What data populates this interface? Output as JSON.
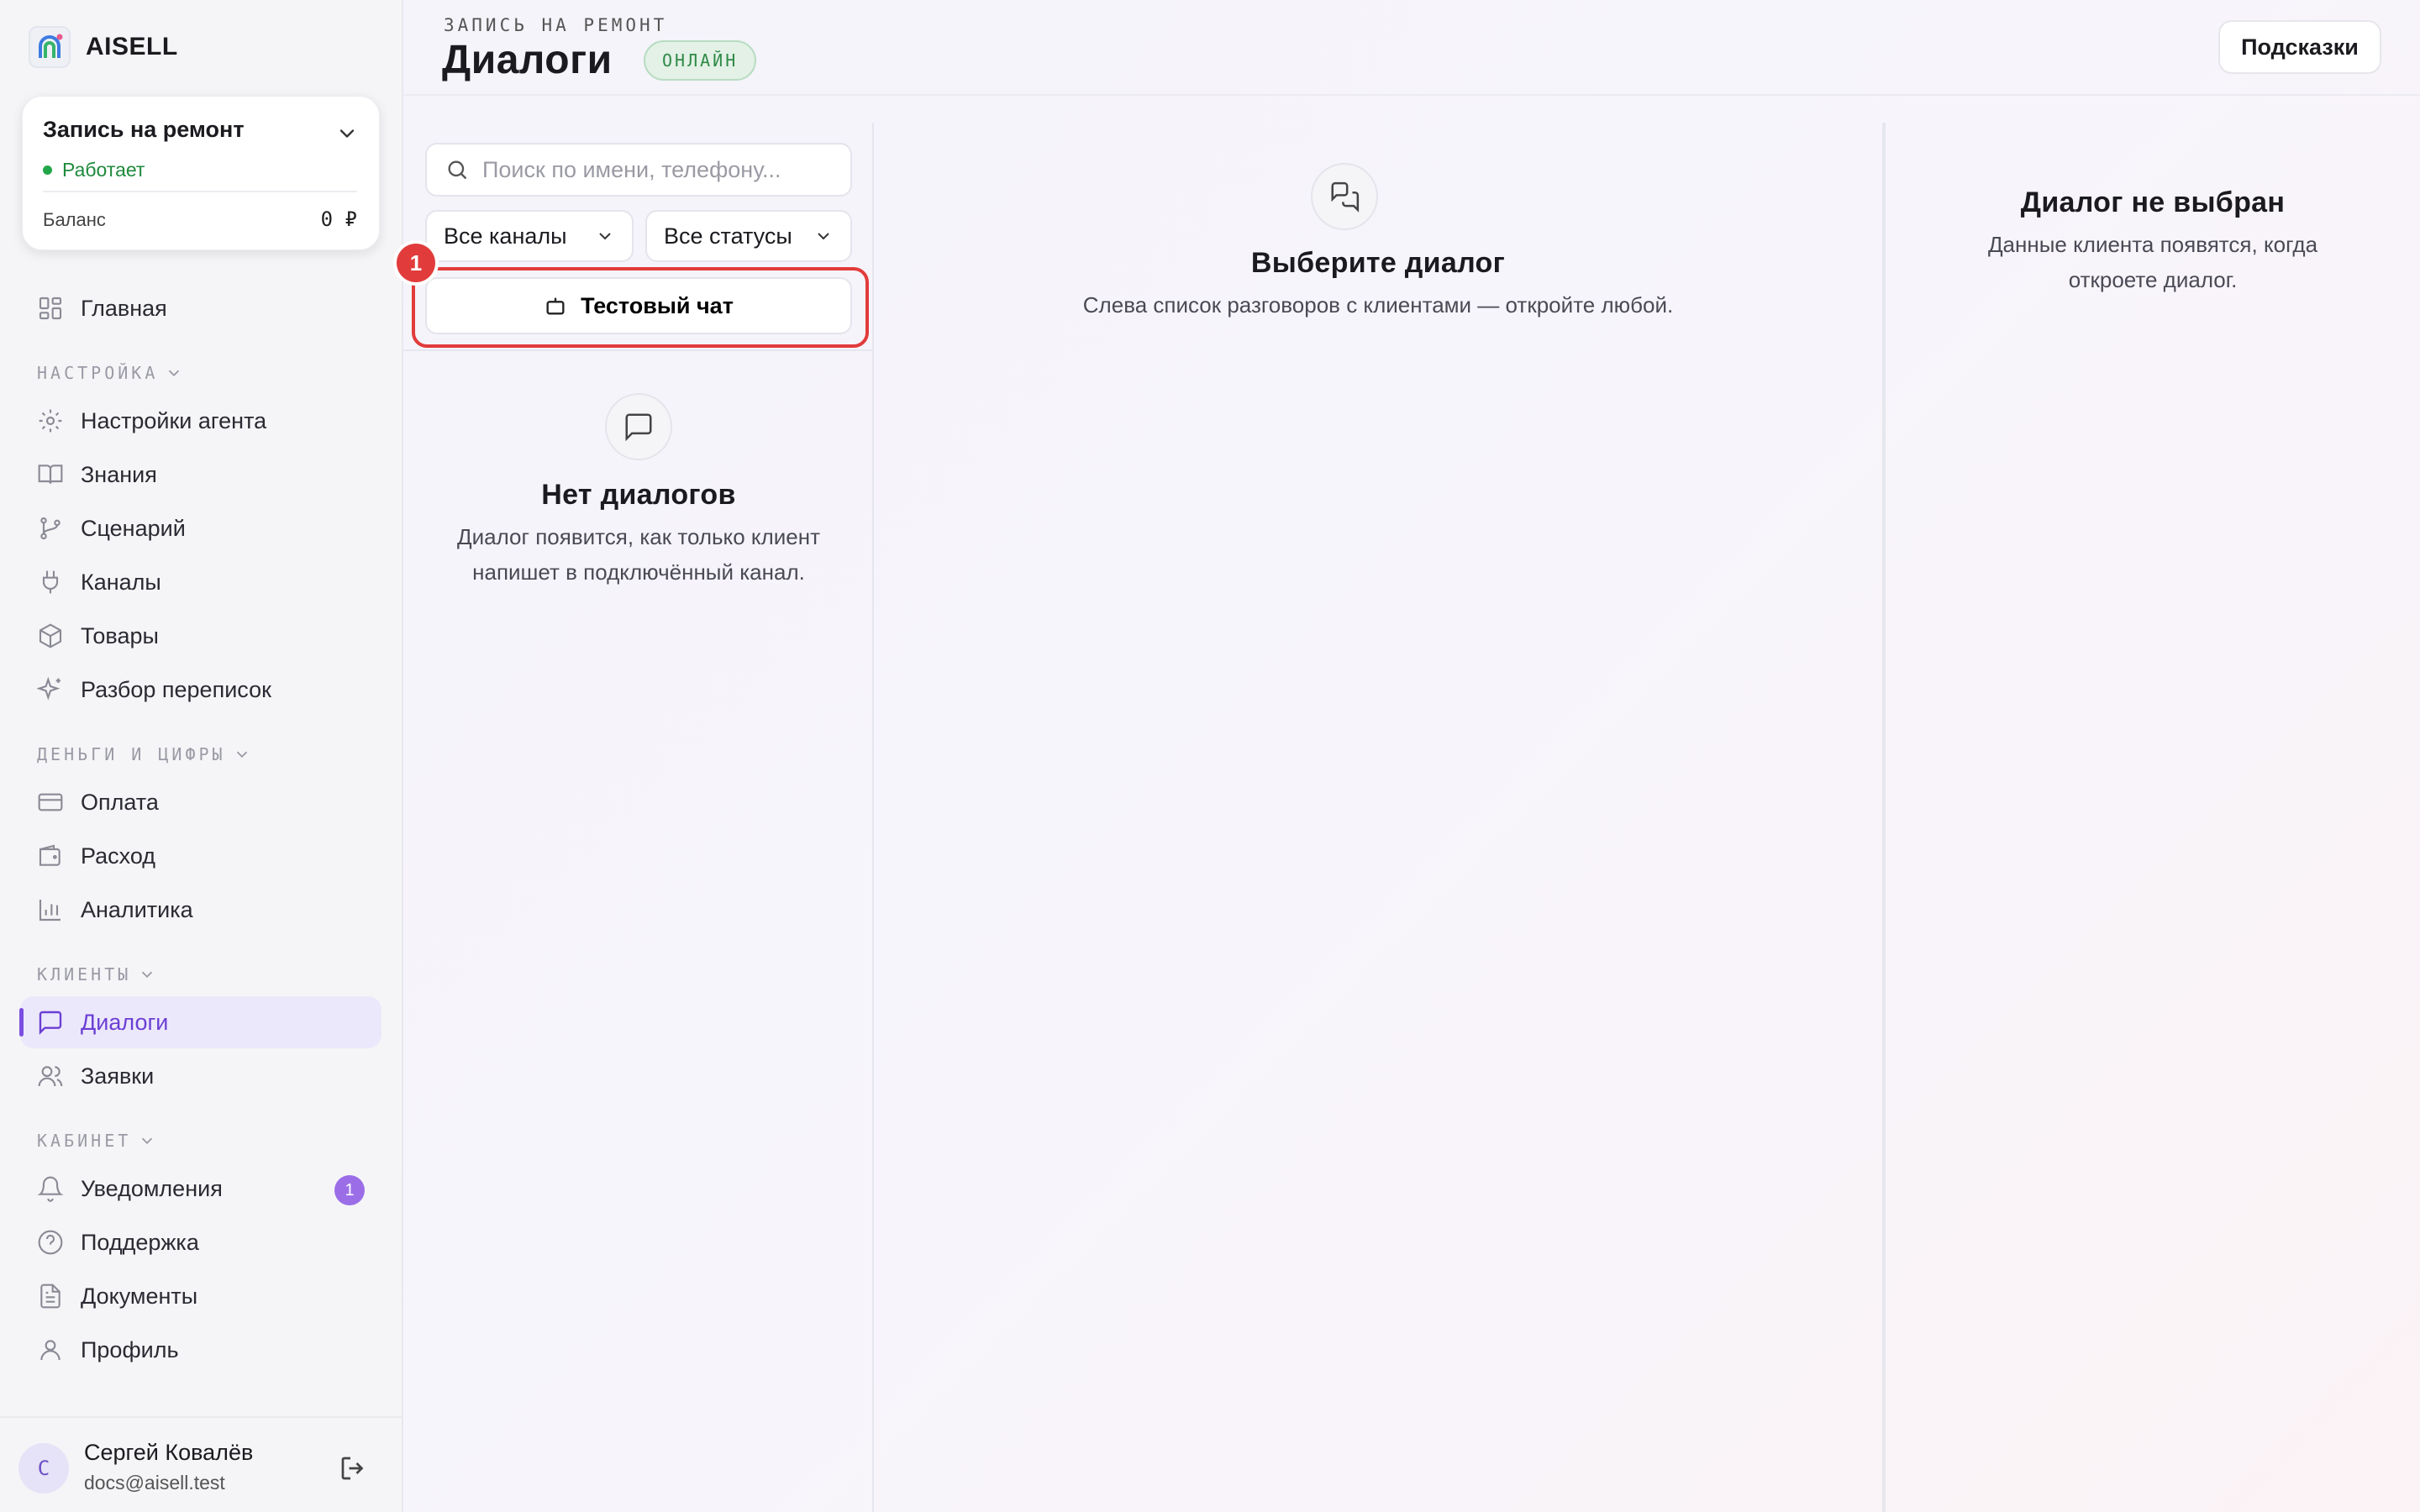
{
  "brand": {
    "name": "AISELL",
    "logo_icon": "aisell-logo-icon"
  },
  "project": {
    "name": "Запись на ремонт",
    "status": "Работает",
    "balance_label": "Баланс",
    "balance_value": "0 ₽"
  },
  "sidebar": {
    "home": "Главная",
    "sections": {
      "settings": "НАСТРОЙКА",
      "money": "ДЕНЬГИ И ЦИФРЫ",
      "clients": "КЛИЕНТЫ",
      "cabinet": "КАБИНЕТ"
    },
    "items": {
      "agent_settings": "Настройки агента",
      "knowledge": "Знания",
      "scenario": "Сценарий",
      "channels": "Каналы",
      "products": "Товары",
      "chat_review": "Разбор переписок",
      "payment": "Оплата",
      "expense": "Расход",
      "analytics": "Аналитика",
      "dialogs": "Диалоги",
      "requests": "Заявки",
      "notifications": "Уведомления",
      "support": "Поддержка",
      "documents": "Документы",
      "profile": "Профиль"
    },
    "notifications_count": "1"
  },
  "user": {
    "initial": "С",
    "name": "Сергей Ковалёв",
    "email": "docs@aisell.test"
  },
  "header": {
    "breadcrumb": "ЗАПИСЬ НА РЕМОНТ",
    "title": "Диалоги",
    "badge": "ОНЛАЙН",
    "hints_button": "Подсказки"
  },
  "list": {
    "search_placeholder": "Поиск по имени, телефону...",
    "channel_filter": "Все каналы",
    "status_filter": "Все статусы",
    "test_chat": "Тестовый чат",
    "step_marker": "1",
    "empty_title": "Нет диалогов",
    "empty_text_line1": "Диалог появится, как только клиент",
    "empty_text_line2": "напишет в подключённый канал."
  },
  "chat": {
    "title": "Выберите диалог",
    "text": "Слева список разговоров с клиентами — откройте любой."
  },
  "info": {
    "title": "Диалог не выбран",
    "text_line1": "Данные клиента появятся, когда",
    "text_line2": "откроете диалог."
  },
  "colors": {
    "accent": "#7a4ee0",
    "active_bg": "#ece8fb",
    "online": "#2e8a47",
    "highlight": "#e23b3b"
  }
}
